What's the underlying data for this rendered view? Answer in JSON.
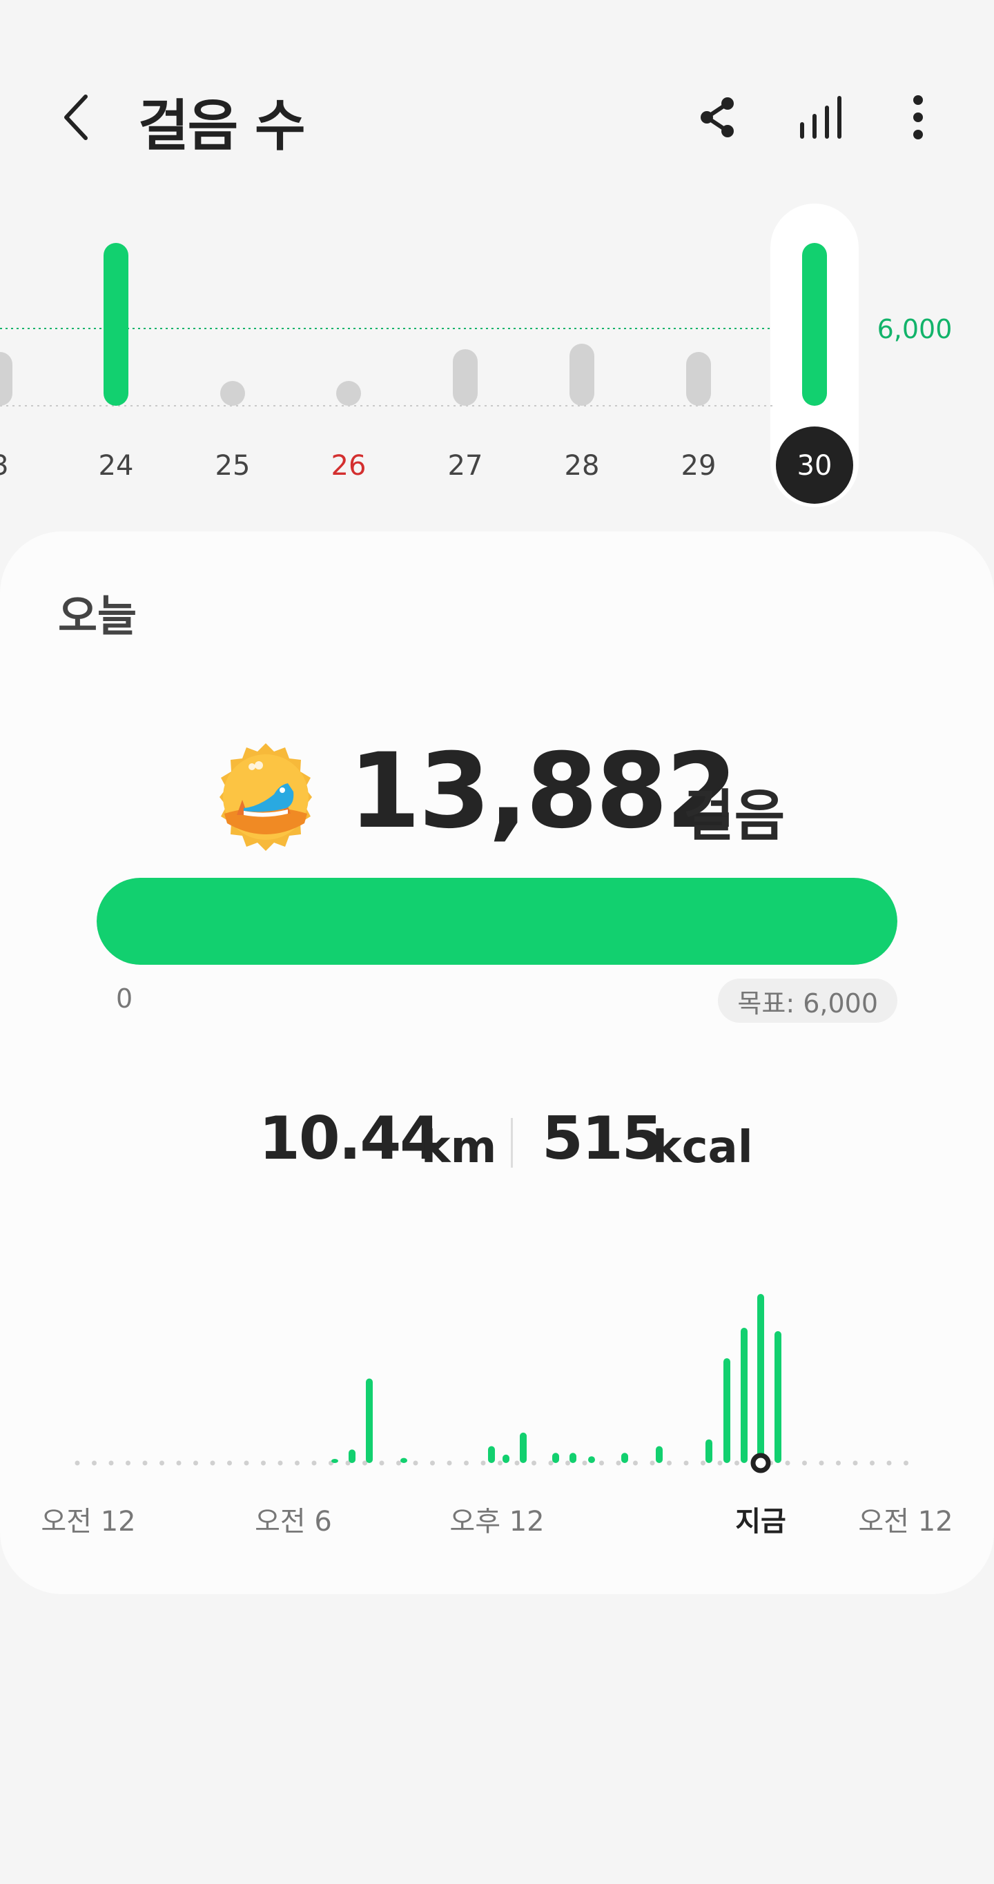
{
  "header": {
    "title": "걸음 수",
    "back_icon": "chevron-left-icon",
    "share_icon": "share-icon",
    "chart_icon": "bar-chart-icon",
    "more_icon": "more-vert-icon"
  },
  "weekly": {
    "goal_label": "6,000",
    "goal_value": 6000,
    "days": [
      "3",
      "24",
      "25",
      "26",
      "27",
      "28",
      "29",
      "30"
    ],
    "holiday": "26",
    "selected": "30",
    "steps_estimate": [
      1700,
      14000,
      0,
      0,
      1800,
      2000,
      1700,
      13882
    ],
    "colors": {
      "goal_met": "#12d06f",
      "below_goal": "#d2d2d2",
      "holiday": "#d32f2f",
      "selected_bg": "#222222"
    }
  },
  "today": {
    "label": "오늘",
    "steps": "13,882",
    "steps_unit": "걸음",
    "badge_icon": "running-shoe-badge-icon",
    "progress": 1.0,
    "progress_min": "0",
    "goal_text": "목표: 6,000",
    "distance": "10.44",
    "distance_unit": "km",
    "calories": "515",
    "calories_unit": "kcal"
  },
  "hourly": {
    "labels": [
      "오전 12",
      "오전 6",
      "오후 12",
      "지금",
      "오전 12"
    ],
    "now_label": "지금",
    "bars_relative": [
      0.02,
      0.08,
      0.5,
      0.03,
      0.1,
      0.05,
      0.18,
      0.06,
      0.06,
      0.04,
      0.06,
      0.1,
      0.14,
      0.62,
      0.8,
      1.0,
      0.78
    ]
  }
}
